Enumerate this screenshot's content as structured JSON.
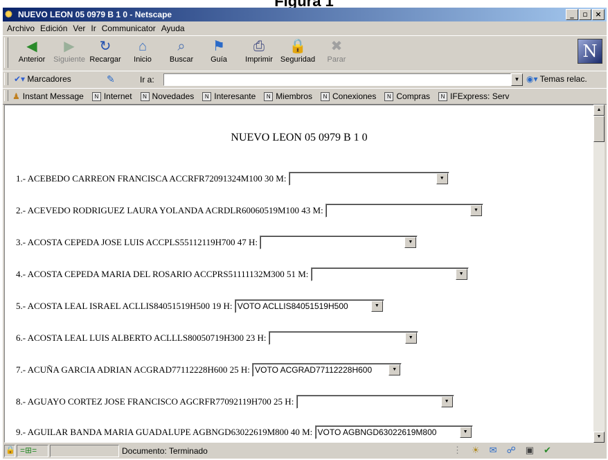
{
  "caption": "Figura 1",
  "window": {
    "title": "NUEVO LEON 05 0979 B 1 0 - Netscape",
    "buttons": [
      "_",
      "ř",
      "X"
    ]
  },
  "menu": [
    "Archivo",
    "Edición",
    "Ver",
    "Ir",
    "Communicator",
    "Ayuda"
  ],
  "toolbar": {
    "buttons": [
      {
        "label": "Anterior",
        "icon": "back-arrow-icon",
        "enabled": true
      },
      {
        "label": "Siguiente",
        "icon": "forward-arrow-icon",
        "enabled": false
      },
      {
        "label": "Recargar",
        "icon": "reload-icon",
        "enabled": true
      },
      {
        "label": "Inicio",
        "icon": "home-icon",
        "enabled": true
      },
      {
        "label": "Buscar",
        "icon": "search-icon",
        "enabled": true
      },
      {
        "label": "Guía",
        "icon": "guide-icon",
        "enabled": true
      },
      {
        "label": "Imprimir",
        "icon": "print-icon",
        "enabled": true
      },
      {
        "label": "Seguridad",
        "icon": "lock-icon",
        "enabled": true
      },
      {
        "label": "Parar",
        "icon": "stop-icon",
        "enabled": false
      }
    ]
  },
  "location": {
    "bookmarks_label": "Marcadores",
    "goto_label": "Ir a:",
    "url": "",
    "related_label": "Temas relac."
  },
  "links": [
    "Instant Message",
    "Internet",
    "Novedades",
    "Interesante",
    "Miembros",
    "Conexiones",
    "Compras",
    "IFExpress: Serv"
  ],
  "document": {
    "title": "NUEVO LEON 05 0979 B 1 0",
    "rows": [
      {
        "text": "1.- ACEBEDO CARREON FRANCISCA ACCRFR72091324M100 30 M:",
        "selected": ""
      },
      {
        "text": "2.- ACEVEDO RODRIGUEZ LAURA YOLANDA ACRDLR60060519M100 43 M:",
        "selected": ""
      },
      {
        "text": "3.- ACOSTA CEPEDA JOSE LUIS ACCPLS55112119H700 47 H:",
        "selected": ""
      },
      {
        "text": "4.- ACOSTA CEPEDA MARIA DEL ROSARIO ACCPRS51111132M300 51 M:",
        "selected": ""
      },
      {
        "text": "5.- ACOSTA LEAL ISRAEL ACLLIS84051519H500 19 H:",
        "selected": "VOTO ACLLIS84051519H500"
      },
      {
        "text": "6.- ACOSTA LEAL LUIS ALBERTO ACLLLS80050719H300 23 H:",
        "selected": ""
      },
      {
        "text": "7.- ACUÑA GARCIA ADRIAN ACGRAD77112228H600 25 H:",
        "selected": "VOTO ACGRAD77112228H600"
      },
      {
        "text": "8.- AGUAYO CORTEZ JOSE FRANCISCO AGCRFR77092119H700 25 H:",
        "selected": ""
      },
      {
        "text": "9.- AGUILAR BANDA MARIA GUADALUPE AGBNGD63022619M800 40 M:",
        "selected": "VOTO AGBNGD63022619M800"
      }
    ]
  },
  "status": {
    "text": "Documento: Terminado"
  }
}
